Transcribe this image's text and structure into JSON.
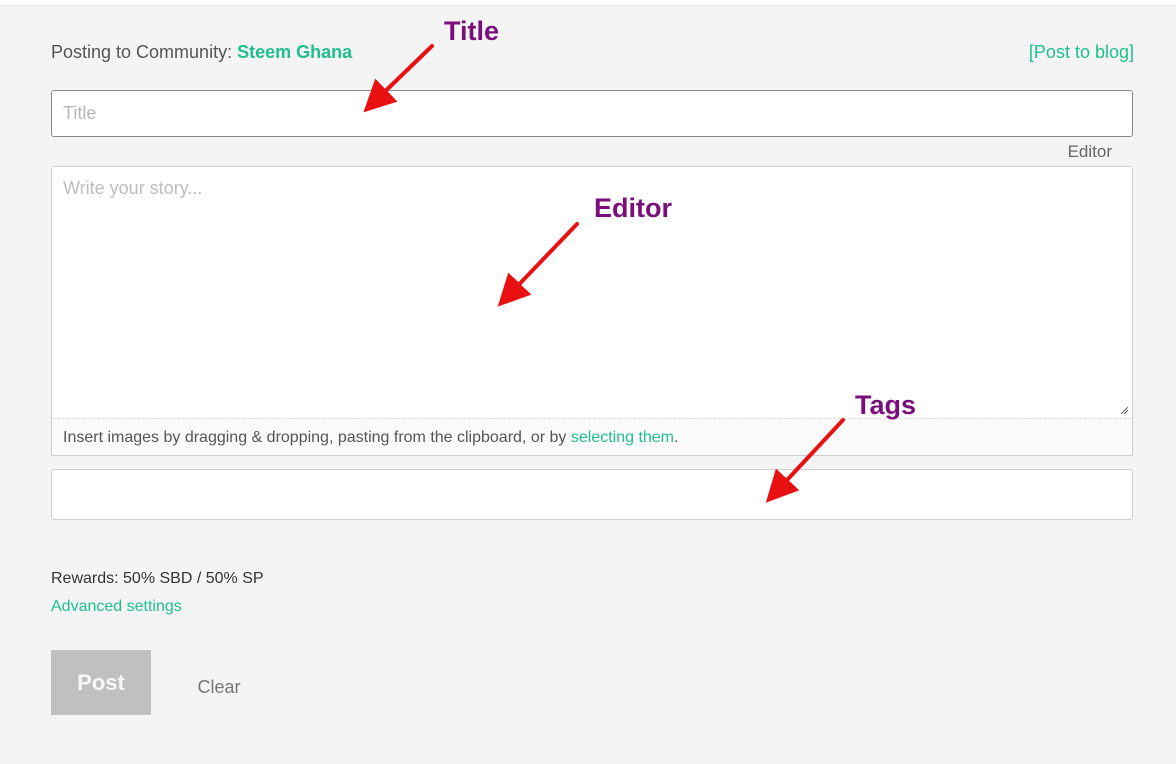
{
  "header": {
    "community_prefix": "Posting to Community: ",
    "community_name": "Steem Ghana",
    "post_to_blog": "[Post to blog]"
  },
  "title_field": {
    "placeholder": "Title",
    "value": ""
  },
  "editor": {
    "toggle_label": "Editor",
    "placeholder": "Write your story...",
    "value": "",
    "footer_text": "Insert images by dragging & dropping, pasting from the clipboard, or by ",
    "footer_link": "selecting them",
    "footer_suffix": "."
  },
  "tags_field": {
    "placeholder": "",
    "value": ""
  },
  "rewards": {
    "label": "Rewards: 50% SBD / 50% SP"
  },
  "advanced_settings": {
    "label": "Advanced settings"
  },
  "actions": {
    "post_label": "Post",
    "clear_label": "Clear"
  },
  "annotations": {
    "title_label": "Title",
    "editor_label": "Editor",
    "tags_label": "Tags",
    "label_color": "#7a0e7a",
    "arrow_color": "#e81010"
  },
  "colors": {
    "accent": "#1fbf8f",
    "background": "#f4f4f4",
    "post_disabled": "#c0c0c0"
  }
}
